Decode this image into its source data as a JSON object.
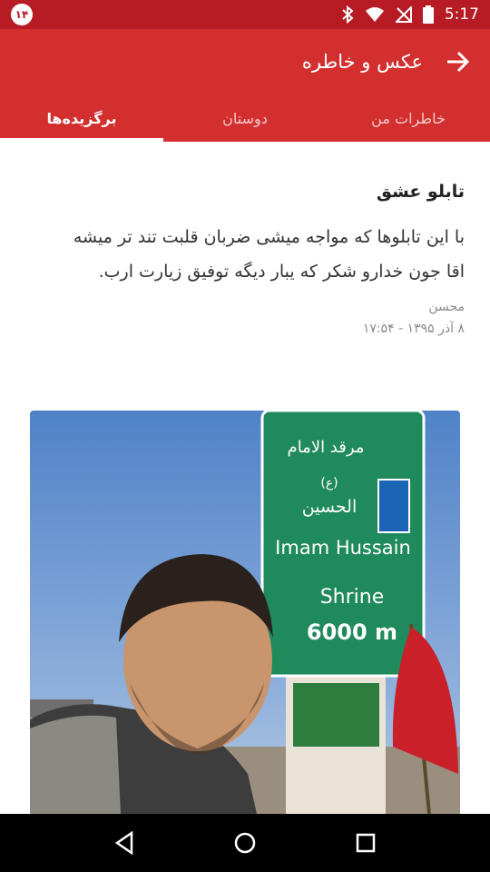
{
  "status_bar": {
    "notification_badge": "۱۴",
    "time": "5:17"
  },
  "app_bar": {
    "title": "عکس و خاطره"
  },
  "tabs": [
    {
      "label": "خاطرات من",
      "active": false
    },
    {
      "label": "دوستان",
      "active": false
    },
    {
      "label": "برگزیده‌ها",
      "active": true
    }
  ],
  "post": {
    "title": "تابلو عشق",
    "body_line1": "با این تابلوها که مواجه میشی ضربان قلبت تند تر میشه",
    "body_line2": "اقا جون خدارو شکر که یبار دیگه توفیق زیارت ارب.",
    "author": "محسن",
    "date": "۸ آذر ۱۳۹۵ - ۱۷:۵۴"
  },
  "photo_sign": {
    "line_arabic1": "مرقد الامام",
    "line_arabic2": "(ع)",
    "line_arabic3": "الحسين",
    "line_en1": "Imam Hussain",
    "line_en2": "Shrine",
    "distance": "6000 m"
  },
  "colors": {
    "status_bar": "#b71c24",
    "app_bar": "#d32f2f",
    "sign_green": "#1f8a5b"
  }
}
